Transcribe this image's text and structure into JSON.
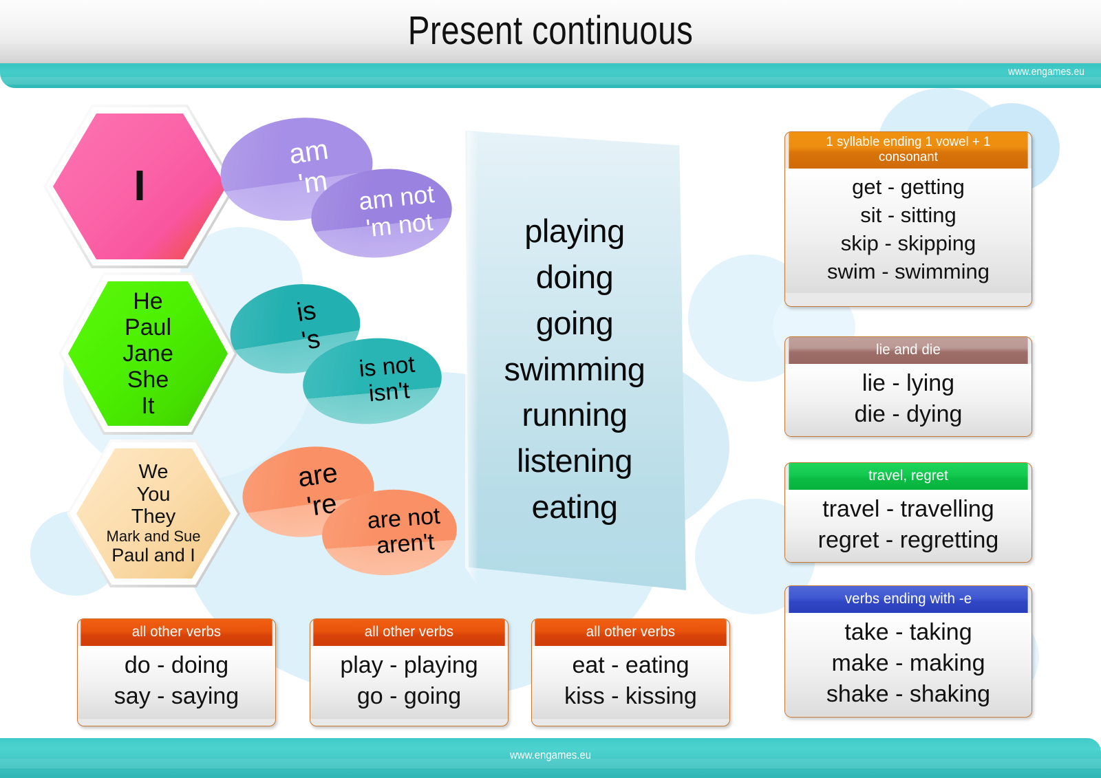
{
  "header": {
    "title": "Present continuous",
    "site_url": "www.engames.eu"
  },
  "footer": {
    "site_url": "www.engames.eu"
  },
  "subjects": [
    {
      "name": "subject-i",
      "lines": [
        "I"
      ],
      "color": "#fb64a8"
    },
    {
      "name": "subject-he",
      "lines": [
        "He",
        "Paul",
        "Jane",
        "She",
        "It"
      ],
      "color": "#4cf000"
    },
    {
      "name": "subject-we",
      "lines": [
        "We",
        "You",
        "They",
        "Mark and Sue",
        "Paul and I"
      ],
      "color": "#fbdcab"
    }
  ],
  "auxiliaries": [
    {
      "positive": [
        "am",
        "'m"
      ],
      "negative": [
        "am not",
        "'m not"
      ],
      "color": "#9a82e0",
      "text_color": "#ffffff"
    },
    {
      "positive": [
        "is",
        "'s"
      ],
      "negative": [
        "is not",
        "isn't"
      ],
      "color": "#2ab5b5",
      "text_color": "#000000"
    },
    {
      "positive": [
        "are",
        "'re"
      ],
      "negative": [
        "are not",
        "aren't"
      ],
      "color": "#fa9065",
      "text_color": "#000000"
    }
  ],
  "verb_panel": {
    "verbs": [
      "playing",
      "doing",
      "going",
      "swimming",
      "running",
      "listening",
      "eating"
    ]
  },
  "rule_cards": [
    {
      "title": "1 syllable ending 1 vowel + 1 consonant",
      "header_color": "#e08a0e",
      "examples": [
        "get - getting",
        "sit - sitting",
        "skip - skipping",
        "swim - swimming"
      ]
    },
    {
      "title": "lie and die",
      "header_color": "#ab817b",
      "examples": [
        "lie - lying",
        "die - dying"
      ]
    },
    {
      "title": "travel, regret",
      "header_color": "#11c94f",
      "examples": [
        "travel - travelling",
        "regret - regretting"
      ]
    },
    {
      "title": "verbs ending with -e",
      "header_color": "#3a51cc",
      "examples": [
        "take - taking",
        "make - making",
        "shake - shaking"
      ]
    }
  ],
  "other_verb_cards": [
    {
      "title": "all other verbs",
      "header_color": "#e3500b",
      "examples": [
        "do - doing",
        "say - saying"
      ]
    },
    {
      "title": "all other verbs",
      "header_color": "#e3500b",
      "examples": [
        "play - playing",
        "go - going"
      ]
    },
    {
      "title": "all other verbs",
      "header_color": "#e3500b",
      "examples": [
        "eat - eating",
        "kiss - kissing"
      ]
    }
  ]
}
